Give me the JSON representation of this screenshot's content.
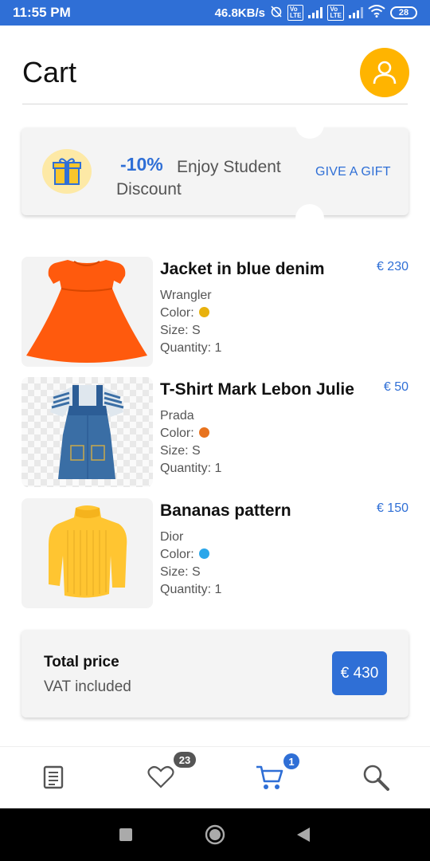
{
  "status_bar": {
    "time": "11:55 PM",
    "network_speed": "46.8KB/s",
    "battery": "28"
  },
  "header": {
    "title": "Cart",
    "avatar_icon": "user-icon",
    "avatar_color": "#ffb400"
  },
  "discount": {
    "icon": "gift-icon",
    "percent": "-10%",
    "text": "Enjoy Student Discount",
    "action_label": "GIVE A GIFT"
  },
  "items": [
    {
      "name": "Jacket in blue denim",
      "brand": "Wrangler",
      "color_label": "Color:",
      "color": "#e8b10d",
      "size": "Size: S",
      "quantity": "Quantity: 1",
      "price": "€ 230"
    },
    {
      "name": "T-Shirt Mark Lebon Julie",
      "brand": "Prada",
      "color_label": "Color:",
      "color": "#e8731e",
      "size": "Size: S",
      "quantity": "Quantity: 1",
      "price": "€ 50"
    },
    {
      "name": "Bananas pattern",
      "brand": "Dior",
      "color_label": "Color:",
      "color": "#2aa6ea",
      "size": "Size: S",
      "quantity": "Quantity: 1",
      "price": "€ 150"
    }
  ],
  "total": {
    "title": "Total price",
    "subtitle": "VAT included",
    "amount": "€ 430"
  },
  "bottom_nav": {
    "items": [
      {
        "icon": "document-icon"
      },
      {
        "icon": "heart-icon",
        "badge": "23"
      },
      {
        "icon": "cart-icon",
        "badge": "1",
        "active": true
      },
      {
        "icon": "search-icon"
      }
    ]
  },
  "colors": {
    "accent": "#2f6fd6",
    "avatar": "#ffb400"
  }
}
